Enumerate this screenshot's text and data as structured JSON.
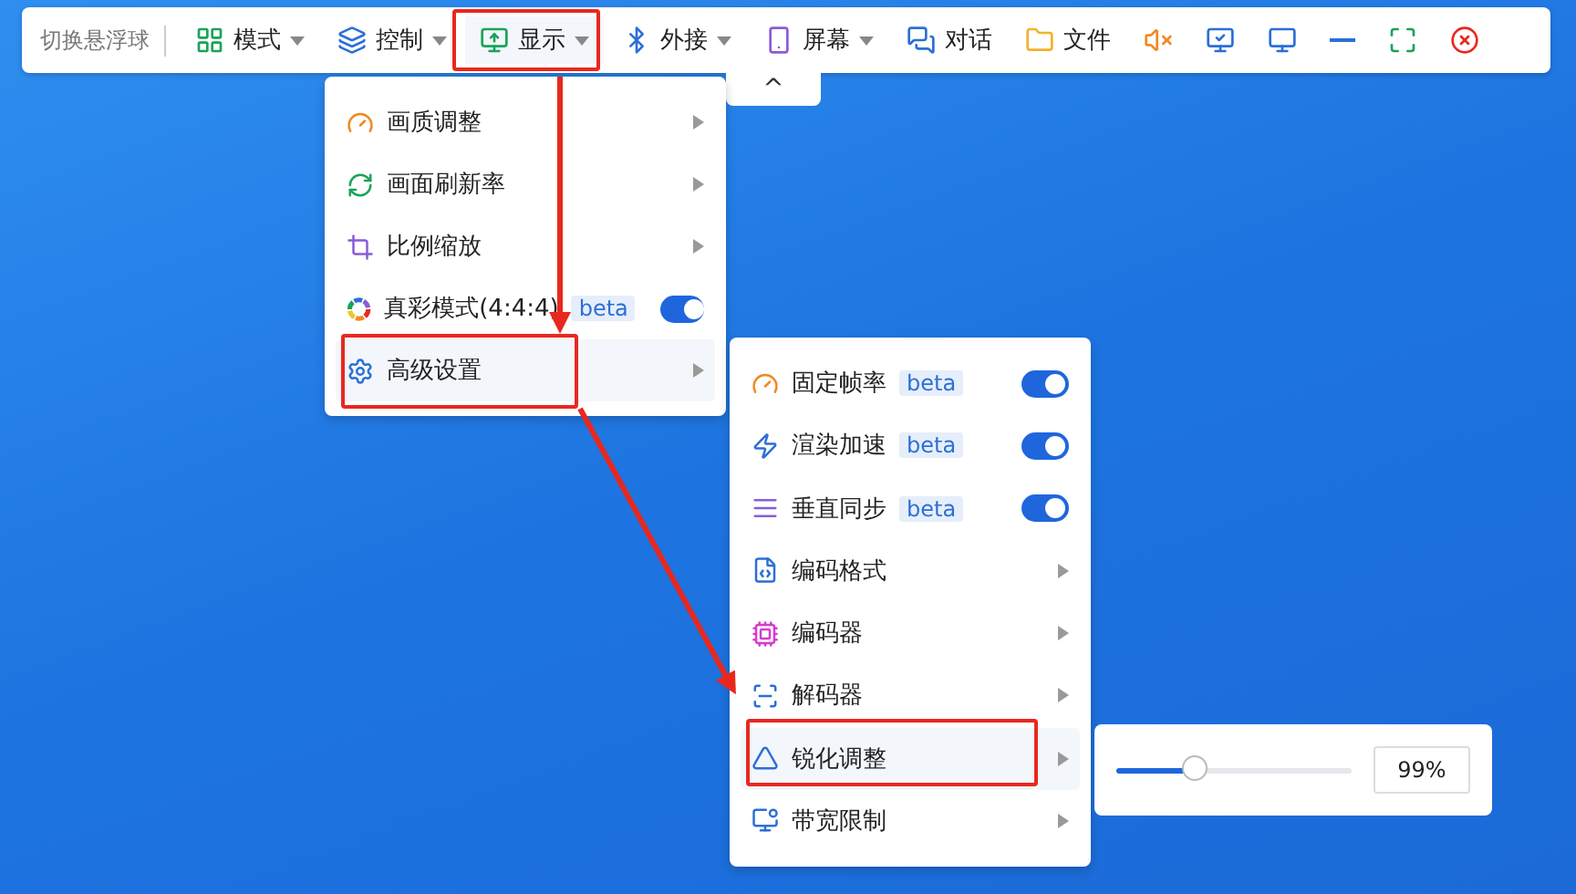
{
  "toolbar": {
    "title": "切换悬浮球",
    "menus": [
      {
        "label": "模式",
        "caret": true,
        "selected": false
      },
      {
        "label": "控制",
        "caret": true,
        "selected": false
      },
      {
        "label": "显示",
        "caret": true,
        "selected": true
      },
      {
        "label": "外接",
        "caret": true,
        "selected": false
      },
      {
        "label": "屏幕",
        "caret": true,
        "selected": false
      },
      {
        "label": "对话",
        "caret": false,
        "selected": false
      },
      {
        "label": "文件",
        "caret": false,
        "selected": false
      }
    ],
    "collapse": "^"
  },
  "display_menu": [
    {
      "label": "画质调整",
      "kind": "submenu",
      "selected": false
    },
    {
      "label": "画面刷新率",
      "kind": "submenu",
      "selected": false
    },
    {
      "label": "比例缩放",
      "kind": "submenu",
      "selected": false
    },
    {
      "label": "真彩模式(4:4:4)",
      "badge": "beta",
      "kind": "toggle",
      "on": true,
      "selected": false
    },
    {
      "label": "高级设置",
      "kind": "submenu",
      "selected": true
    }
  ],
  "advanced_menu": [
    {
      "label": "固定帧率",
      "badge": "beta",
      "kind": "toggle",
      "on": true,
      "selected": false
    },
    {
      "label": "渲染加速",
      "badge": "beta",
      "kind": "toggle",
      "on": true,
      "selected": false
    },
    {
      "label": "垂直同步",
      "badge": "beta",
      "kind": "toggle",
      "on": true,
      "selected": false
    },
    {
      "label": "编码格式",
      "kind": "submenu",
      "selected": false
    },
    {
      "label": "编码器",
      "kind": "submenu",
      "selected": false
    },
    {
      "label": "解码器",
      "kind": "submenu",
      "selected": false
    },
    {
      "label": "锐化调整",
      "kind": "submenu",
      "selected": true
    },
    {
      "label": "带宽限制",
      "kind": "submenu",
      "selected": false
    }
  ],
  "sharpen": {
    "level": 0.33,
    "value": "99%"
  }
}
